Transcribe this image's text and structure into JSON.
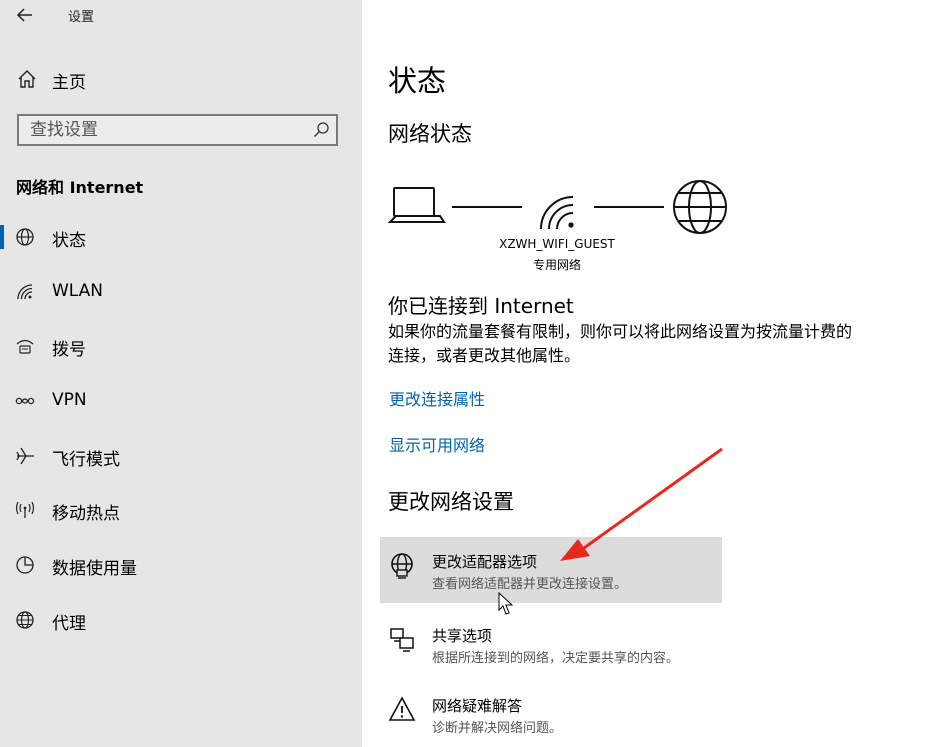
{
  "window": {
    "title": "设置"
  },
  "sidebar": {
    "home_label": "主页",
    "search_placeholder": "查找设置",
    "section_title": "网络和 Internet",
    "items": [
      {
        "label": "状态",
        "icon": "globe-status-icon",
        "active": true
      },
      {
        "label": "WLAN",
        "icon": "wifi-icon"
      },
      {
        "label": "拨号",
        "icon": "dialup-icon"
      },
      {
        "label": "VPN",
        "icon": "vpn-icon"
      },
      {
        "label": "飞行模式",
        "icon": "airplane-icon"
      },
      {
        "label": "移动热点",
        "icon": "hotspot-icon"
      },
      {
        "label": "数据使用量",
        "icon": "data-usage-icon"
      },
      {
        "label": "代理",
        "icon": "proxy-globe-icon"
      }
    ]
  },
  "main": {
    "title": "状态",
    "network_status_heading": "网络状态",
    "diagram": {
      "ssid": "XZWH_WIFI_GUEST",
      "network_type": "专用网络"
    },
    "connected_title": "你已连接到 Internet",
    "connected_desc": "如果你的流量套餐有限制，则你可以将此网络设置为按流量计费的连接，或者更改其他属性。",
    "links": {
      "change_properties": "更改连接属性",
      "show_networks": "显示可用网络"
    },
    "change_settings_heading": "更改网络设置",
    "options": [
      {
        "title": "更改适配器选项",
        "desc": "查看网络适配器并更改连接设置。",
        "icon": "adapter-icon"
      },
      {
        "title": "共享选项",
        "desc": "根据所连接到的网络，决定要共享的内容。",
        "icon": "sharing-icon"
      },
      {
        "title": "网络疑难解答",
        "desc": "诊断并解决网络问题。",
        "icon": "warning-icon"
      }
    ]
  },
  "colors": {
    "sidebar_bg": "#e6e6e6",
    "accent": "#0063b1",
    "annotation_arrow": "#e8281f",
    "hover_bg": "#dcdcdc"
  }
}
